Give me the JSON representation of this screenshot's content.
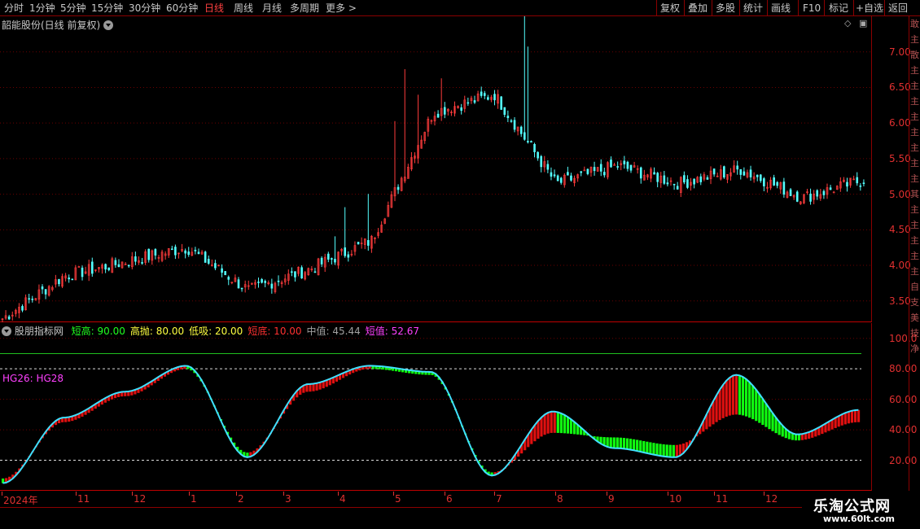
{
  "toolbar": {
    "periods": [
      "分时",
      "1分钟",
      "5分钟",
      "15分钟",
      "30分钟",
      "60分钟",
      "日线",
      "周线",
      "月线",
      "多周期",
      "更多 >"
    ],
    "active_period": "日线",
    "actions": [
      "复权",
      "叠加",
      "多股",
      "统计",
      "画线",
      "F10",
      "标记",
      "+自选",
      "返回"
    ]
  },
  "main_chart": {
    "title": "韶能股份(日线 前复权)",
    "price_axis": [
      "7.00",
      "6.50",
      "6.00",
      "5.50",
      "5.00",
      "4.50",
      "4.00",
      "3.50"
    ]
  },
  "indicator": {
    "name": "股朋指标网",
    "params": [
      {
        "label": "短高:",
        "value": "90.00",
        "color": "#20ff20"
      },
      {
        "label": "高抛:",
        "value": "80.00",
        "color": "#ffff40"
      },
      {
        "label": "低吸:",
        "value": "20.00",
        "color": "#ffff40"
      },
      {
        "label": "短底:",
        "value": "10.00",
        "color": "#ff3030"
      },
      {
        "label": "中值:",
        "value": "45.44",
        "color": "#a0a0a0"
      },
      {
        "label": "短值:",
        "value": "52.67",
        "color": "#ff40ff"
      }
    ],
    "hg_label": "HG26: HG28",
    "axis": [
      "100.0",
      "80.00",
      "60.00",
      "40.00",
      "20.00"
    ]
  },
  "date_axis": [
    "2024年",
    "11",
    "12",
    "1",
    "2",
    "3",
    "4",
    "5",
    "6",
    "7",
    "8",
    "9",
    "10",
    "11",
    "12"
  ],
  "right_strip": [
    "敢",
    "主",
    "散",
    "主",
    "主",
    "主",
    "主",
    "主",
    "主",
    "主",
    "主",
    "其",
    "主",
    "主",
    "主",
    "主",
    "主",
    "自",
    "支",
    "美",
    "技",
    "净"
  ],
  "watermark": {
    "title": "乐淘公式网",
    "url": "www.60lt.com"
  },
  "chart_data": {
    "type": "line",
    "title": "韶能股份(日线 前复权)",
    "xlabel": "",
    "ylabel": "",
    "ylim": [
      3.2,
      7.5
    ],
    "categories": [
      "2024-10",
      "2024-11",
      "2024-12",
      "2025-01",
      "2025-02",
      "2025-03",
      "2025-04",
      "2025-05",
      "2025-06",
      "2025-07",
      "2025-08",
      "2025-09",
      "2025-10",
      "2025-11",
      "2025-12"
    ],
    "series": [
      {
        "values": [
          3.25,
          3.85,
          4.05,
          4.25,
          3.65,
          3.95,
          4.35,
          6.15,
          6.4,
          5.15,
          5.4,
          5.15,
          5.35,
          4.95,
          5.2
        ]
      }
    ],
    "indicator_ylim": [
      0,
      110
    ],
    "indicator_series": [
      {
        "name": "短值",
        "values": [
          5,
          48,
          65,
          82,
          22,
          70,
          82,
          78,
          10,
          52,
          28,
          22,
          76,
          37,
          53
        ]
      },
      {
        "name": "中值",
        "values": [
          8,
          45,
          62,
          80,
          25,
          65,
          80,
          76,
          12,
          38,
          35,
          30,
          50,
          33,
          45
        ]
      }
    ]
  }
}
